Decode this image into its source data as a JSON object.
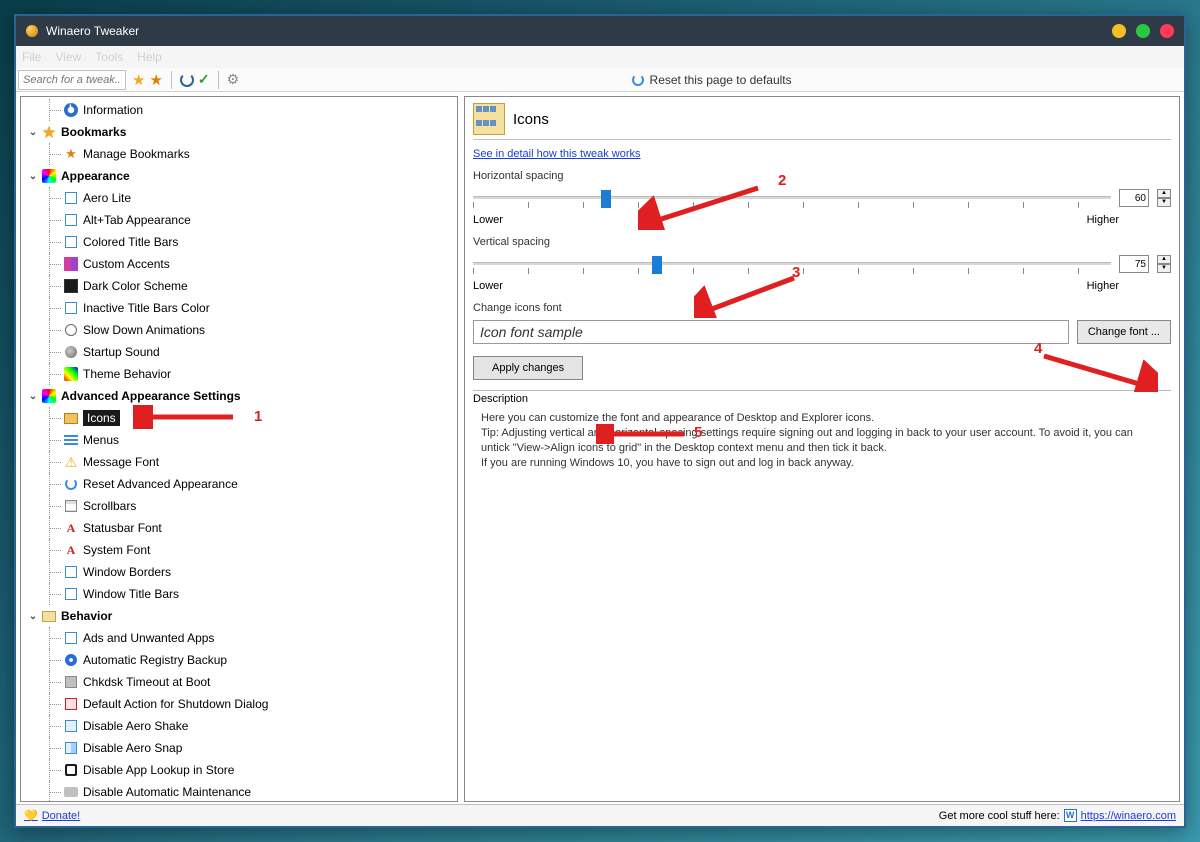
{
  "window": {
    "title": "Winaero Tweaker"
  },
  "menubar": [
    "File",
    "View",
    "Tools",
    "Help"
  ],
  "toolbar": {
    "search_placeholder": "Search for a tweak...",
    "reset_label": "Reset this page to defaults"
  },
  "tree": {
    "top_item": "Information",
    "categories": [
      {
        "name": "Bookmarks",
        "items": [
          {
            "label": "Manage Bookmarks",
            "icon": "starb"
          }
        ]
      },
      {
        "name": "Appearance",
        "icon": "rainbow",
        "items": [
          {
            "label": "Aero Lite",
            "icon": "sq"
          },
          {
            "label": "Alt+Tab Appearance",
            "icon": "sq"
          },
          {
            "label": "Colored Title Bars",
            "icon": "sq"
          },
          {
            "label": "Custom Accents",
            "icon": "accent"
          },
          {
            "label": "Dark Color Scheme",
            "icon": "dark"
          },
          {
            "label": "Inactive Title Bars Color",
            "icon": "sq"
          },
          {
            "label": "Slow Down Animations",
            "icon": "clock"
          },
          {
            "label": "Startup Sound",
            "icon": "sound"
          },
          {
            "label": "Theme Behavior",
            "icon": "theme"
          }
        ]
      },
      {
        "name": "Advanced Appearance Settings",
        "icon": "rainbow",
        "items": [
          {
            "label": "Icons",
            "icon": "folder",
            "selected": true
          },
          {
            "label": "Menus",
            "icon": "menu"
          },
          {
            "label": "Message Font",
            "icon": "warn"
          },
          {
            "label": "Reset Advanced Appearance",
            "icon": "reset"
          },
          {
            "label": "Scrollbars",
            "icon": "scroll"
          },
          {
            "label": "Statusbar Font",
            "icon": "a"
          },
          {
            "label": "System Font",
            "icon": "a"
          },
          {
            "label": "Window Borders",
            "icon": "sq"
          },
          {
            "label": "Window Title Bars",
            "icon": "sq"
          }
        ]
      },
      {
        "name": "Behavior",
        "icon": "behav",
        "items": [
          {
            "label": "Ads and Unwanted Apps",
            "icon": "sq"
          },
          {
            "label": "Automatic Registry Backup",
            "icon": "reg"
          },
          {
            "label": "Chkdsk Timeout at Boot",
            "icon": "disk"
          },
          {
            "label": "Default Action for Shutdown Dialog",
            "icon": "shut"
          },
          {
            "label": "Disable Aero Shake",
            "icon": "shake"
          },
          {
            "label": "Disable Aero Snap",
            "icon": "snap"
          },
          {
            "label": "Disable App Lookup in Store",
            "icon": "store"
          },
          {
            "label": "Disable Automatic Maintenance",
            "icon": "maint"
          }
        ]
      }
    ]
  },
  "main": {
    "title": "Icons",
    "detail_link": "See in detail how this tweak works",
    "hslider": {
      "label": "Horizontal spacing",
      "value": 60,
      "low": "Lower",
      "high": "Higher",
      "percent": 20
    },
    "vslider": {
      "label": "Vertical spacing",
      "value": 75,
      "low": "Lower",
      "high": "Higher",
      "percent": 28
    },
    "font_label": "Change icons font",
    "font_sample": "Icon font sample",
    "change_font_btn": "Change font ...",
    "apply_btn": "Apply changes",
    "desc_label": "Description",
    "desc_line1": "Here you can customize the font and appearance of Desktop and Explorer icons.",
    "desc_line2": "Tip: Adjusting vertical and horizontal spacing settings require signing out and logging in back to your user account. To avoid it, you can untick \"View->Align icons to grid\" in the Desktop context menu and then tick it back.",
    "desc_line3": "If you are running Windows 10, you have to sign out and log in back anyway."
  },
  "statusbar": {
    "donate": "Donate!",
    "tagline": "Get more cool stuff here:",
    "url": "https://winaero.com"
  },
  "annotations": [
    "1",
    "2",
    "3",
    "4",
    "5"
  ]
}
